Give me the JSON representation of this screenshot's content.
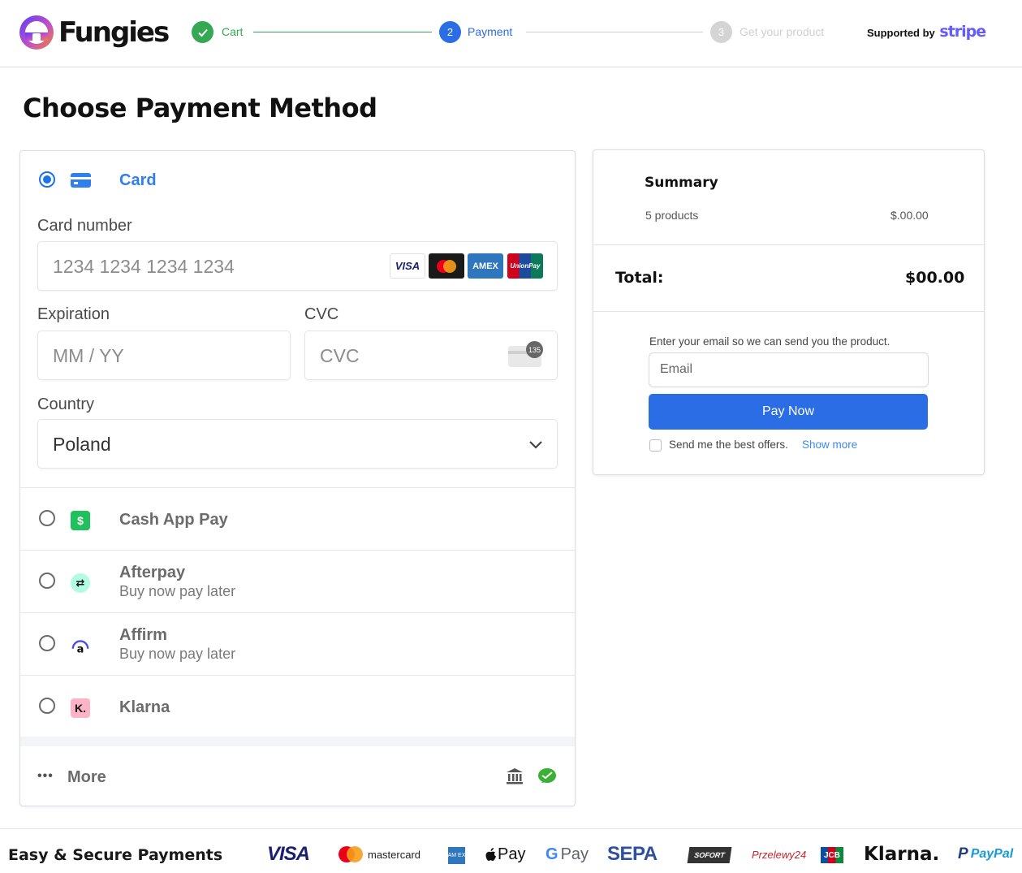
{
  "app": {
    "brand": "Fungies",
    "supported_by": "Supported by",
    "stripe": "stripe"
  },
  "steps": [
    {
      "label": "Cart",
      "number": "✓",
      "state": "done"
    },
    {
      "label": "Payment",
      "number": "2",
      "state": "active"
    },
    {
      "label": "Get your product",
      "number": "3",
      "state": "pending"
    }
  ],
  "page": {
    "title": "Choose Payment Method"
  },
  "card": {
    "method_label": "Card",
    "card_number_label": "Card number",
    "card_number_placeholder": "1234 1234 1234 1234",
    "brands": [
      "VISA",
      "Mastercard",
      "AMEX",
      "UnionPay"
    ],
    "expiration_label": "Expiration",
    "expiration_placeholder": "MM / YY",
    "cvc_label": "CVC",
    "cvc_placeholder": "CVC",
    "cvc_icon_text": "135",
    "country_label": "Country",
    "country_value": "Poland"
  },
  "methods": [
    {
      "name": "Cash App Pay",
      "sub": "",
      "icon": "cash-app-icon"
    },
    {
      "name": "Afterpay",
      "sub": "Buy now pay later",
      "icon": "afterpay-icon"
    },
    {
      "name": "Affirm",
      "sub": "Buy now pay later",
      "icon": "affirm-icon"
    },
    {
      "name": "Klarna",
      "sub": "",
      "icon": "klarna-icon"
    }
  ],
  "more": {
    "label": "More",
    "icons": [
      "bank-icon",
      "wechat-pay-icon"
    ]
  },
  "summary": {
    "title": "Summary",
    "products_label": "5 products",
    "products_amount": "$.00.00",
    "total_label": "Total:",
    "total_amount": "$00.00",
    "email_prompt": "Enter your email so we can send you the product.",
    "email_placeholder": "Email",
    "pay_button": "Pay Now",
    "offers_text": "Send me the best offers.",
    "offers_link": "Show more"
  },
  "footer": {
    "title": "Easy & Secure Payments",
    "logos": {
      "visa": "VISA",
      "mastercard": "mastercard",
      "amex": "AM EX",
      "applepay": "Pay",
      "googlepay": "Pay",
      "sepa": "SEPA",
      "sofort": "SOFORT",
      "przelewy": "Przelewy24",
      "jcb": "JCB",
      "klarna": "Klarna.",
      "paypal": "PayPal"
    }
  },
  "colors": {
    "accent": "#2b6de5",
    "done": "#34a853",
    "stripe": "#635bff",
    "link": "#3b8be8"
  }
}
